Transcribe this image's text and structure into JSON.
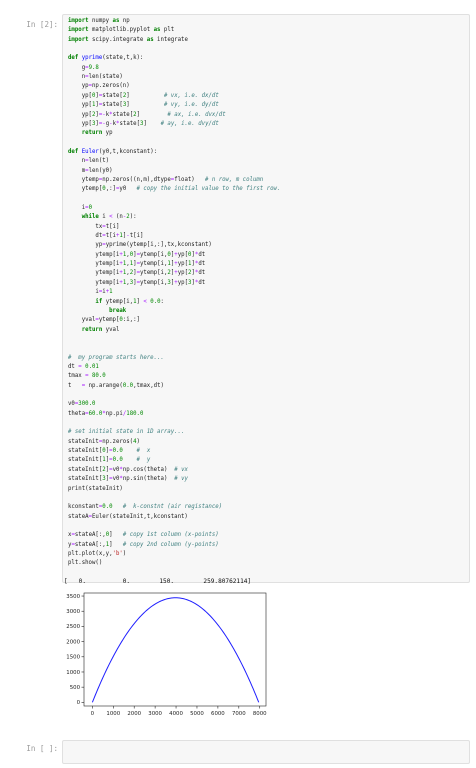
{
  "input_prompt": "In [2]:",
  "empty_prompt": "In [ ]:",
  "code": [
    [
      [
        "k",
        "import"
      ],
      [
        "t",
        " numpy "
      ],
      [
        "k",
        "as"
      ],
      [
        "t",
        " np"
      ]
    ],
    [
      [
        "k",
        "import"
      ],
      [
        "t",
        " matplotlib.pyplot "
      ],
      [
        "k",
        "as"
      ],
      [
        "t",
        " plt"
      ]
    ],
    [
      [
        "k",
        "import"
      ],
      [
        "t",
        " scipy.integrate "
      ],
      [
        "k",
        "as"
      ],
      [
        "t",
        " integrate"
      ]
    ],
    [],
    [
      [
        "k",
        "def"
      ],
      [
        "t",
        " "
      ],
      [
        "f",
        "yprime"
      ],
      [
        "t",
        "(state,t,k):"
      ]
    ],
    [
      [
        "t",
        "    g"
      ],
      [
        "o",
        "="
      ],
      [
        "n",
        "9.8"
      ]
    ],
    [
      [
        "t",
        "    n"
      ],
      [
        "o",
        "="
      ],
      [
        "t",
        "len(state)"
      ]
    ],
    [
      [
        "t",
        "    yp"
      ],
      [
        "o",
        "="
      ],
      [
        "t",
        "np.zeros(n)"
      ]
    ],
    [
      [
        "t",
        "    yp["
      ],
      [
        "n",
        "0"
      ],
      [
        "t",
        "]"
      ],
      [
        "o",
        "="
      ],
      [
        "t",
        "state["
      ],
      [
        "n",
        "2"
      ],
      [
        "t",
        "]          "
      ],
      [
        "c",
        "# vx, i.e. dx/dt"
      ]
    ],
    [
      [
        "t",
        "    yp["
      ],
      [
        "n",
        "1"
      ],
      [
        "t",
        "]"
      ],
      [
        "o",
        "="
      ],
      [
        "t",
        "state["
      ],
      [
        "n",
        "3"
      ],
      [
        "t",
        "]          "
      ],
      [
        "c",
        "# vy, i.e. dy/dt"
      ]
    ],
    [
      [
        "t",
        "    yp["
      ],
      [
        "n",
        "2"
      ],
      [
        "t",
        "]"
      ],
      [
        "o",
        "="
      ],
      [
        "o",
        "-"
      ],
      [
        "t",
        "k"
      ],
      [
        "o",
        "*"
      ],
      [
        "t",
        "state["
      ],
      [
        "n",
        "2"
      ],
      [
        "t",
        "]        "
      ],
      [
        "c",
        "# ax, i.e. dvx/dt"
      ]
    ],
    [
      [
        "t",
        "    yp["
      ],
      [
        "n",
        "3"
      ],
      [
        "t",
        "]"
      ],
      [
        "o",
        "=-"
      ],
      [
        "t",
        "g"
      ],
      [
        "o",
        "-"
      ],
      [
        "t",
        "k"
      ],
      [
        "o",
        "*"
      ],
      [
        "t",
        "state["
      ],
      [
        "n",
        "3"
      ],
      [
        "t",
        "]    "
      ],
      [
        "c",
        "# ay, i.e. dvy/dt"
      ]
    ],
    [
      [
        "t",
        "    "
      ],
      [
        "k",
        "return"
      ],
      [
        "t",
        " yp"
      ]
    ],
    [],
    [
      [
        "k",
        "def"
      ],
      [
        "t",
        " "
      ],
      [
        "f",
        "Euler"
      ],
      [
        "t",
        "(y0,t,kconstant):"
      ]
    ],
    [
      [
        "t",
        "    n"
      ],
      [
        "o",
        "="
      ],
      [
        "t",
        "len(t)"
      ]
    ],
    [
      [
        "t",
        "    m"
      ],
      [
        "o",
        "="
      ],
      [
        "t",
        "len(y0)"
      ]
    ],
    [
      [
        "t",
        "    ytemp"
      ],
      [
        "o",
        "="
      ],
      [
        "t",
        "np.zeros((n,m),dtype"
      ],
      [
        "o",
        "="
      ],
      [
        "t",
        "float)   "
      ],
      [
        "c",
        "# n row, m column"
      ]
    ],
    [
      [
        "t",
        "    ytemp["
      ],
      [
        "n",
        "0"
      ],
      [
        "t",
        ",:]"
      ],
      [
        "o",
        "="
      ],
      [
        "t",
        "y0   "
      ],
      [
        "c",
        "# copy the initial value to the first row."
      ]
    ],
    [],
    [
      [
        "t",
        "    i"
      ],
      [
        "o",
        "="
      ],
      [
        "n",
        "0"
      ]
    ],
    [
      [
        "t",
        "    "
      ],
      [
        "k",
        "while"
      ],
      [
        "t",
        " i "
      ],
      [
        "o",
        "<"
      ],
      [
        "t",
        " (n"
      ],
      [
        "o",
        "-"
      ],
      [
        "n",
        "2"
      ],
      [
        "t",
        "):"
      ]
    ],
    [
      [
        "t",
        "        tx"
      ],
      [
        "o",
        "="
      ],
      [
        "t",
        "t[i]"
      ]
    ],
    [
      [
        "t",
        "        dt"
      ],
      [
        "o",
        "="
      ],
      [
        "t",
        "t[i"
      ],
      [
        "o",
        "+"
      ],
      [
        "n",
        "1"
      ],
      [
        "t",
        "]"
      ],
      [
        "o",
        "-"
      ],
      [
        "t",
        "t[i]"
      ]
    ],
    [
      [
        "t",
        "        yp"
      ],
      [
        "o",
        "="
      ],
      [
        "t",
        "yprime(ytemp[i,:],tx,kconstant)"
      ]
    ],
    [
      [
        "t",
        "        ytemp[i"
      ],
      [
        "o",
        "+"
      ],
      [
        "n",
        "1"
      ],
      [
        "t",
        ","
      ],
      [
        "n",
        "0"
      ],
      [
        "t",
        "]"
      ],
      [
        "o",
        "="
      ],
      [
        "t",
        "ytemp[i,"
      ],
      [
        "n",
        "0"
      ],
      [
        "t",
        "]"
      ],
      [
        "o",
        "+"
      ],
      [
        "t",
        "yp["
      ],
      [
        "n",
        "0"
      ],
      [
        "t",
        "]"
      ],
      [
        "o",
        "*"
      ],
      [
        "t",
        "dt"
      ]
    ],
    [
      [
        "t",
        "        ytemp[i"
      ],
      [
        "o",
        "+"
      ],
      [
        "n",
        "1"
      ],
      [
        "t",
        ","
      ],
      [
        "n",
        "1"
      ],
      [
        "t",
        "]"
      ],
      [
        "o",
        "="
      ],
      [
        "t",
        "ytemp[i,"
      ],
      [
        "n",
        "1"
      ],
      [
        "t",
        "]"
      ],
      [
        "o",
        "+"
      ],
      [
        "t",
        "yp["
      ],
      [
        "n",
        "1"
      ],
      [
        "t",
        "]"
      ],
      [
        "o",
        "*"
      ],
      [
        "t",
        "dt"
      ]
    ],
    [
      [
        "t",
        "        ytemp[i"
      ],
      [
        "o",
        "+"
      ],
      [
        "n",
        "1"
      ],
      [
        "t",
        ","
      ],
      [
        "n",
        "2"
      ],
      [
        "t",
        "]"
      ],
      [
        "o",
        "="
      ],
      [
        "t",
        "ytemp[i,"
      ],
      [
        "n",
        "2"
      ],
      [
        "t",
        "]"
      ],
      [
        "o",
        "+"
      ],
      [
        "t",
        "yp["
      ],
      [
        "n",
        "2"
      ],
      [
        "t",
        "]"
      ],
      [
        "o",
        "*"
      ],
      [
        "t",
        "dt"
      ]
    ],
    [
      [
        "t",
        "        ytemp[i"
      ],
      [
        "o",
        "+"
      ],
      [
        "n",
        "1"
      ],
      [
        "t",
        ","
      ],
      [
        "n",
        "3"
      ],
      [
        "t",
        "]"
      ],
      [
        "o",
        "="
      ],
      [
        "t",
        "ytemp[i,"
      ],
      [
        "n",
        "3"
      ],
      [
        "t",
        "]"
      ],
      [
        "o",
        "+"
      ],
      [
        "t",
        "yp["
      ],
      [
        "n",
        "3"
      ],
      [
        "t",
        "]"
      ],
      [
        "o",
        "*"
      ],
      [
        "t",
        "dt"
      ]
    ],
    [
      [
        "t",
        "        i"
      ],
      [
        "o",
        "="
      ],
      [
        "t",
        "i"
      ],
      [
        "o",
        "+"
      ],
      [
        "n",
        "1"
      ]
    ],
    [
      [
        "t",
        "        "
      ],
      [
        "k",
        "if"
      ],
      [
        "t",
        " ytemp[i,"
      ],
      [
        "n",
        "1"
      ],
      [
        "t",
        "] "
      ],
      [
        "o",
        "<"
      ],
      [
        "t",
        " "
      ],
      [
        "n",
        "0.0"
      ],
      [
        "t",
        ":"
      ]
    ],
    [
      [
        "t",
        "            "
      ],
      [
        "k",
        "break"
      ]
    ],
    [
      [
        "t",
        "    yval"
      ],
      [
        "o",
        "="
      ],
      [
        "t",
        "ytemp["
      ],
      [
        "n",
        "0"
      ],
      [
        "t",
        ":i,:]"
      ]
    ],
    [
      [
        "t",
        "    "
      ],
      [
        "k",
        "return"
      ],
      [
        "t",
        " yval"
      ]
    ],
    [],
    [],
    [
      [
        "c",
        "#  my program starts here..."
      ]
    ],
    [
      [
        "t",
        "dt "
      ],
      [
        "o",
        "="
      ],
      [
        "t",
        " "
      ],
      [
        "n",
        "0.01"
      ]
    ],
    [
      [
        "t",
        "tmax "
      ],
      [
        "o",
        "="
      ],
      [
        "t",
        " "
      ],
      [
        "n",
        "80.0"
      ]
    ],
    [
      [
        "t",
        "t   "
      ],
      [
        "o",
        "="
      ],
      [
        "t",
        " np.arange("
      ],
      [
        "n",
        "0.0"
      ],
      [
        "t",
        ",tmax,dt)"
      ]
    ],
    [],
    [
      [
        "t",
        "v0"
      ],
      [
        "o",
        "="
      ],
      [
        "n",
        "300.0"
      ]
    ],
    [
      [
        "t",
        "theta"
      ],
      [
        "o",
        "="
      ],
      [
        "n",
        "60.0"
      ],
      [
        "o",
        "*"
      ],
      [
        "t",
        "np.pi"
      ],
      [
        "o",
        "/"
      ],
      [
        "n",
        "180.0"
      ]
    ],
    [],
    [
      [
        "c",
        "# set initial state in 1D array..."
      ]
    ],
    [
      [
        "t",
        "stateInit"
      ],
      [
        "o",
        "="
      ],
      [
        "t",
        "np.zeros("
      ],
      [
        "n",
        "4"
      ],
      [
        "t",
        ")"
      ]
    ],
    [
      [
        "t",
        "stateInit["
      ],
      [
        "n",
        "0"
      ],
      [
        "t",
        "]"
      ],
      [
        "o",
        "="
      ],
      [
        "n",
        "0.0"
      ],
      [
        "t",
        "    "
      ],
      [
        "c",
        "#  x"
      ]
    ],
    [
      [
        "t",
        "stateInit["
      ],
      [
        "n",
        "1"
      ],
      [
        "t",
        "]"
      ],
      [
        "o",
        "="
      ],
      [
        "n",
        "0.0"
      ],
      [
        "t",
        "    "
      ],
      [
        "c",
        "#  y"
      ]
    ],
    [
      [
        "t",
        "stateInit["
      ],
      [
        "n",
        "2"
      ],
      [
        "t",
        "]"
      ],
      [
        "o",
        "="
      ],
      [
        "t",
        "v0"
      ],
      [
        "o",
        "*"
      ],
      [
        "t",
        "np.cos(theta)  "
      ],
      [
        "c",
        "# vx"
      ]
    ],
    [
      [
        "t",
        "stateInit["
      ],
      [
        "n",
        "3"
      ],
      [
        "t",
        "]"
      ],
      [
        "o",
        "="
      ],
      [
        "t",
        "v0"
      ],
      [
        "o",
        "*"
      ],
      [
        "t",
        "np.sin(theta)  "
      ],
      [
        "c",
        "# vy"
      ]
    ],
    [
      [
        "t",
        "print(stateInit)"
      ]
    ],
    [],
    [
      [
        "t",
        "kconstant"
      ],
      [
        "o",
        "="
      ],
      [
        "n",
        "0.0"
      ],
      [
        "t",
        "   "
      ],
      [
        "c",
        "#  k-constnt (air registance)"
      ]
    ],
    [
      [
        "t",
        "stateA"
      ],
      [
        "o",
        "="
      ],
      [
        "t",
        "Euler(stateInit,t,kconstant)"
      ]
    ],
    [],
    [
      [
        "t",
        "x"
      ],
      [
        "o",
        "="
      ],
      [
        "t",
        "stateA[:,"
      ],
      [
        "n",
        "0"
      ],
      [
        "t",
        "]   "
      ],
      [
        "c",
        "# copy 1st column (x-points)"
      ]
    ],
    [
      [
        "t",
        "y"
      ],
      [
        "o",
        "="
      ],
      [
        "t",
        "stateA[:,"
      ],
      [
        "n",
        "1"
      ],
      [
        "t",
        "]   "
      ],
      [
        "c",
        "# copy 2nd column (y-points)"
      ]
    ],
    [
      [
        "t",
        "plt.plot(x,y,"
      ],
      [
        "s",
        "'b'"
      ],
      [
        "t",
        ")"
      ]
    ],
    [
      [
        "t",
        "plt.show()"
      ]
    ]
  ],
  "output_text": "[   0.          0.        150.        259.80762114]",
  "chart_data": {
    "type": "line",
    "series": [
      {
        "color": "#1f1fff",
        "equation": "y = 1.7320508*x - 0.00021778*x^2",
        "x_start": 0,
        "x_end": 7953
      }
    ],
    "xlim": [
      -400,
      8300
    ],
    "ylim": [
      -120,
      3600
    ],
    "xticks": [
      0,
      1000,
      2000,
      3000,
      4000,
      5000,
      6000,
      7000,
      8000
    ],
    "yticks": [
      0,
      500,
      1000,
      1500,
      2000,
      2500,
      3000,
      3500
    ],
    "grid": false
  }
}
